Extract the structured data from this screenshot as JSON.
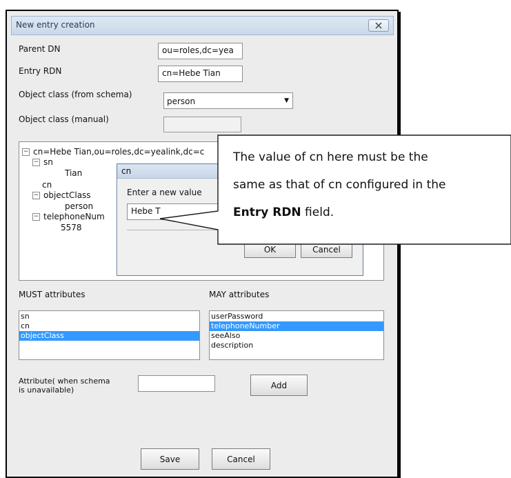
{
  "dialog": {
    "title": "New entry creation",
    "parent_dn_label": "Parent DN",
    "parent_dn_value": "ou=roles,dc=yea",
    "entry_rdn_label": "Entry RDN",
    "entry_rdn_value": "cn=Hebe Tian",
    "object_class_schema_label": "Object class (from schema)",
    "object_class_schema_value": "person",
    "object_class_manual_label": "Object class (manual)",
    "object_class_manual_value": "",
    "must_label": "MUST attributes",
    "may_label": "MAY attributes",
    "attr_label_line1": "Attribute( when schema",
    "attr_label_line2": "is unavailable)",
    "attr_value": "",
    "add_label": "Add",
    "save_label": "Save",
    "cancel_label": "Cancel"
  },
  "tree": {
    "root": "cn=Hebe Tian,ou=roles,dc=yealink,dc=c",
    "sn": "sn",
    "sn_value": "Tian",
    "cn": "cn",
    "object_class": "objectClass",
    "object_class_value": "person",
    "telephone": "telephoneNum",
    "telephone_value": "5578"
  },
  "must_items": [
    "sn",
    "cn",
    "objectClass"
  ],
  "must_selected": 2,
  "may_items": [
    "userPassword",
    "telephoneNumber",
    "seeAlso",
    "description"
  ],
  "may_selected": 1,
  "sub_dialog": {
    "title": "cn",
    "prompt": "Enter a new value",
    "value": "Hebe T",
    "ok_label": "OK",
    "cancel_label": "Cancel"
  },
  "callout": {
    "line1": "The value of cn here must be the",
    "line2": "same as that of cn configured in the",
    "line3_bold": "Entry RDN",
    "line3_rest": " field."
  },
  "icons": {
    "close": "close-icon",
    "dropdown": "chevron-down-icon",
    "expand": "collapse-minus-icon"
  }
}
